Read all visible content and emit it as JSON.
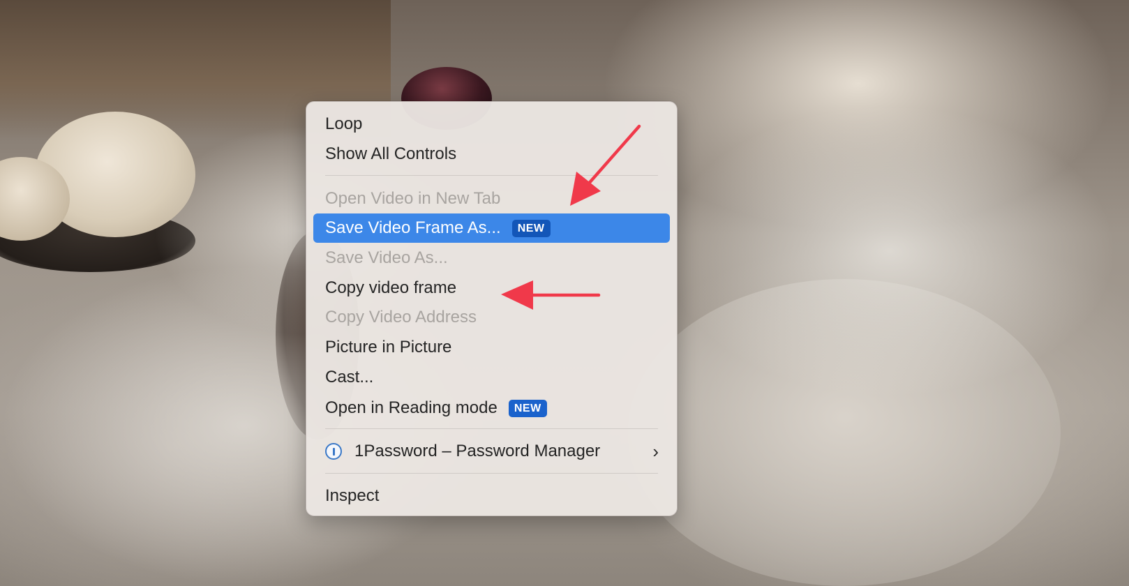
{
  "menu": {
    "items": [
      {
        "label": "Loop",
        "state": "enabled"
      },
      {
        "label": "Show All Controls",
        "state": "enabled"
      },
      {
        "label": "Open Video in New Tab",
        "state": "disabled"
      },
      {
        "label": "Save Video Frame As...",
        "state": "selected",
        "badge": "NEW"
      },
      {
        "label": "Save Video As...",
        "state": "disabled"
      },
      {
        "label": "Copy video frame",
        "state": "enabled"
      },
      {
        "label": "Copy Video Address",
        "state": "disabled"
      },
      {
        "label": "Picture in Picture",
        "state": "enabled"
      },
      {
        "label": "Cast...",
        "state": "enabled"
      },
      {
        "label": "Open in Reading mode",
        "state": "enabled",
        "badge": "NEW"
      },
      {
        "label": "1Password – Password Manager",
        "state": "enabled",
        "icon": "1password-icon",
        "submenu": "chevron-right-icon"
      },
      {
        "label": "Inspect",
        "state": "enabled"
      }
    ]
  },
  "colors": {
    "selection": "#3c87e8",
    "badge": "#1a62cc",
    "annotation_arrow": "#f0394a",
    "disabled_text": "#a8a4a0"
  },
  "annotations": {
    "arrows": [
      "points-to-save-video-frame",
      "points-to-copy-video-frame"
    ]
  }
}
